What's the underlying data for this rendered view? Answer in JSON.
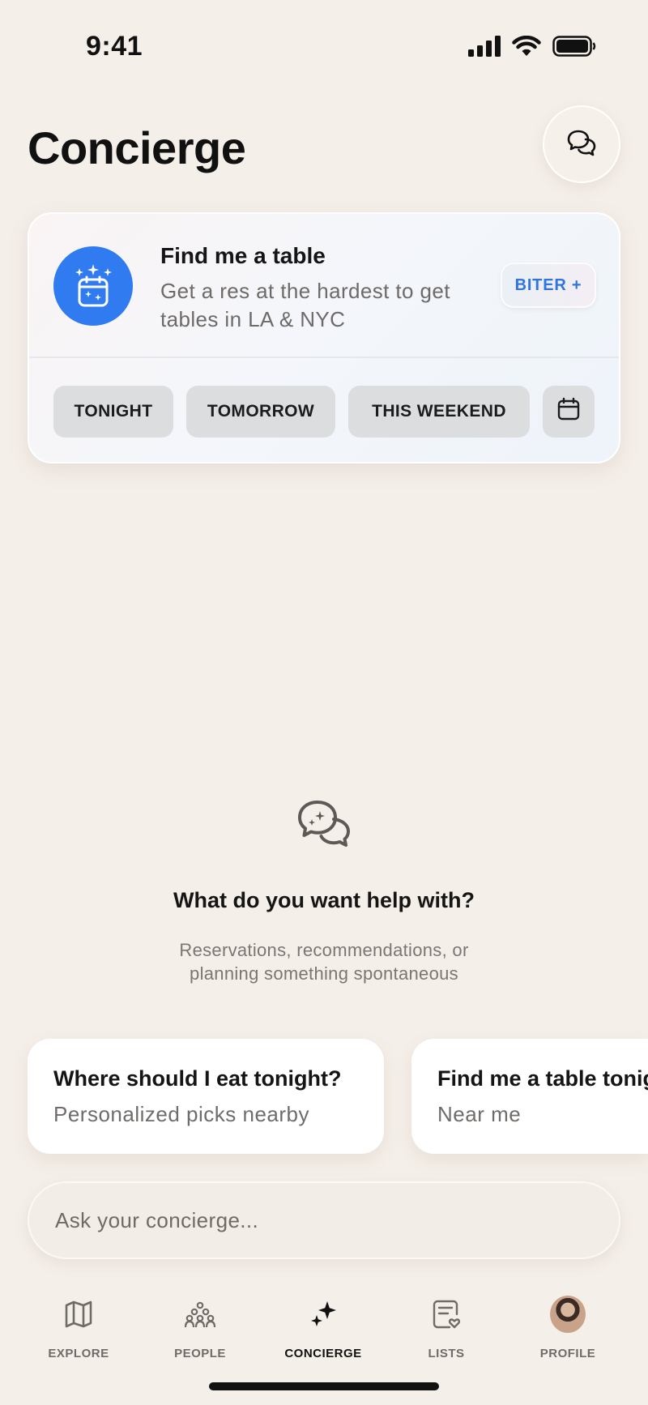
{
  "status_bar": {
    "time": "9:41"
  },
  "header": {
    "title": "Concierge"
  },
  "table_card": {
    "title": "Find me a table",
    "subtitle": "Get a res at the hardest to get tables in LA & NYC",
    "badge": "BITER +",
    "chips": [
      "TONIGHT",
      "TOMORROW",
      "THIS WEEKEND"
    ]
  },
  "empty_state": {
    "title": "What do you want help with?",
    "subtitle_line1": "Reservations, recommendations, or",
    "subtitle_line2": "planning something spontaneous"
  },
  "suggestions": [
    {
      "title": "Where should I eat tonight?",
      "subtitle": "Personalized picks nearby"
    },
    {
      "title": "Find me a table tonight",
      "subtitle": "Near me"
    }
  ],
  "input": {
    "placeholder": "Ask your concierge..."
  },
  "tabs": [
    {
      "label": "EXPLORE",
      "icon": "map-icon"
    },
    {
      "label": "PEOPLE",
      "icon": "people-icon"
    },
    {
      "label": "CONCIERGE",
      "icon": "sparkles-icon"
    },
    {
      "label": "LISTS",
      "icon": "list-heart-icon"
    },
    {
      "label": "PROFILE",
      "icon": "avatar"
    }
  ],
  "colors": {
    "accent_blue": "#2f7bef",
    "background": "#f5efe9"
  }
}
